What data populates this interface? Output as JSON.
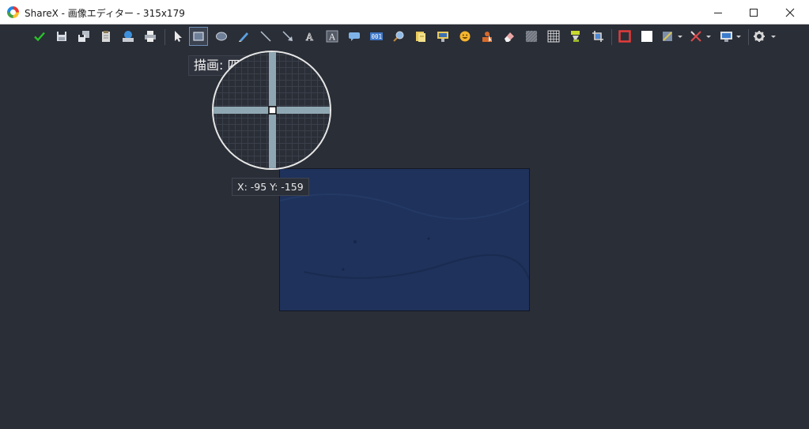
{
  "window": {
    "title": "ShareX - 画像エディター - 315x179",
    "app_icon": "sharex-logo-icon",
    "buttons": [
      {
        "name": "minimize-button",
        "icon": "minimize-icon"
      },
      {
        "name": "maximize-button",
        "icon": "maximize-icon"
      },
      {
        "name": "close-button",
        "icon": "close-icon"
      }
    ]
  },
  "toolbar": {
    "active_tool": "rectangle-tool",
    "items": [
      {
        "name": "confirm-button",
        "icon": "checkmark-icon"
      },
      {
        "name": "save-button",
        "icon": "save-icon"
      },
      {
        "name": "save-as-button",
        "icon": "save-as-icon"
      },
      {
        "name": "copy-button",
        "icon": "clipboard-icon"
      },
      {
        "name": "upload-button",
        "icon": "upload-icon"
      },
      {
        "name": "print-button",
        "icon": "print-icon"
      },
      {
        "name": "select-tool",
        "icon": "cursor-arrow-icon"
      },
      {
        "name": "rectangle-tool",
        "icon": "rectangle-icon"
      },
      {
        "name": "ellipse-tool",
        "icon": "ellipse-icon"
      },
      {
        "name": "freehand-tool",
        "icon": "pencil-icon"
      },
      {
        "name": "line-tool",
        "icon": "line-icon"
      },
      {
        "name": "arrow-tool",
        "icon": "arrow-icon"
      },
      {
        "name": "text-outline-tool",
        "icon": "text-outline-icon"
      },
      {
        "name": "text-background-tool",
        "icon": "text-background-icon"
      },
      {
        "name": "speech-balloon-tool",
        "icon": "speech-balloon-icon"
      },
      {
        "name": "step-tool",
        "icon": "step-counter-icon"
      },
      {
        "name": "magnify-tool",
        "icon": "magnifier-icon"
      },
      {
        "name": "sticker-tool",
        "icon": "sticker-icon"
      },
      {
        "name": "image-tool",
        "icon": "image-insert-icon"
      },
      {
        "name": "emoji-tool",
        "icon": "emoji-icon"
      },
      {
        "name": "cursor-tool",
        "icon": "mouse-cursor-icon"
      },
      {
        "name": "eraser-tool",
        "icon": "eraser-icon"
      },
      {
        "name": "blur-tool",
        "icon": "blur-icon"
      },
      {
        "name": "pixelate-tool",
        "icon": "pixelate-icon"
      },
      {
        "name": "highlight-tool",
        "icon": "highlighter-icon"
      },
      {
        "name": "crop-tool",
        "icon": "crop-icon"
      },
      {
        "name": "border-color-button",
        "icon": "border-color-icon"
      },
      {
        "name": "fill-color-button",
        "icon": "fill-color-icon"
      },
      {
        "name": "shadow-menu-button",
        "icon": "shadow-icon"
      },
      {
        "name": "edit-menu-button",
        "icon": "tools-icon"
      },
      {
        "name": "image-menu-button",
        "icon": "image-menu-icon"
      },
      {
        "name": "options-menu-button",
        "icon": "gear-icon"
      }
    ],
    "tooltip": "描画: 四角形(R)"
  },
  "canvas": {
    "image_color": "#1f325b",
    "cursor_coordinates": "X: -95 Y: -159"
  },
  "colors": {
    "background": "#2a2e37",
    "titlebar": "#ffffff",
    "border_color": "#e23b3b",
    "fill_color": "#ffffff",
    "confirm": "#29c229",
    "crosshair": "#8fa7b3"
  }
}
